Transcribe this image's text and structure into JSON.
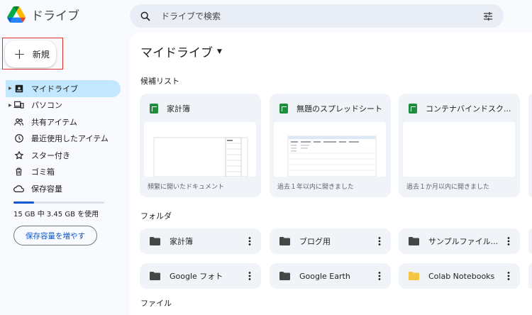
{
  "app": {
    "title": "ドライブ"
  },
  "search": {
    "placeholder": "ドライブで検索"
  },
  "new_button": {
    "label": "新規"
  },
  "sidebar": {
    "items": [
      {
        "label": "マイドライブ",
        "icon": "my-drive-icon",
        "active": true,
        "caret": true
      },
      {
        "label": "パソコン",
        "icon": "computers-icon",
        "active": false,
        "caret": true
      },
      {
        "label": "共有アイテム",
        "icon": "shared-icon",
        "active": false,
        "caret": false
      },
      {
        "label": "最近使用したアイテム",
        "icon": "recent-icon",
        "active": false,
        "caret": false
      },
      {
        "label": "スター付き",
        "icon": "star-icon",
        "active": false,
        "caret": false
      },
      {
        "label": "ゴミ箱",
        "icon": "trash-icon",
        "active": false,
        "caret": false
      },
      {
        "label": "保存容量",
        "icon": "cloud-icon",
        "active": false,
        "caret": false
      }
    ],
    "storage_used_fraction": 0.23,
    "storage_text": "15 GB 中 3.45 GB を使用",
    "upgrade_label": "保存容量を増やす"
  },
  "main": {
    "title": "マイドライブ",
    "suggested_label": "候補リスト",
    "suggested": [
      {
        "name": "家計簿",
        "subtitle": "頻繁に開いたドキュメント"
      },
      {
        "name": "無題のスプレッドシート",
        "subtitle": "過去１年以内に開きました"
      },
      {
        "name": "コンテナバインドスク...",
        "subtitle": "過去１か月以内に開きました"
      }
    ],
    "folders_label": "フォルダ",
    "folders": [
      {
        "name": "家計簿",
        "color": "#444746"
      },
      {
        "name": "ブログ用",
        "color": "#444746"
      },
      {
        "name": "サンプルファイル...",
        "color": "#444746"
      },
      {
        "name": "Google フォト",
        "color": "#444746"
      },
      {
        "name": "Google Earth",
        "color": "#444746"
      },
      {
        "name": "Colab Notebooks",
        "color": "#f4c542"
      }
    ],
    "files_label": "ファイル"
  },
  "colors": {
    "accent": "#0b57d0",
    "active_bg": "#c2e7ff",
    "sheets_green": "#1e8e3e",
    "highlight_red": "#e0302d"
  }
}
